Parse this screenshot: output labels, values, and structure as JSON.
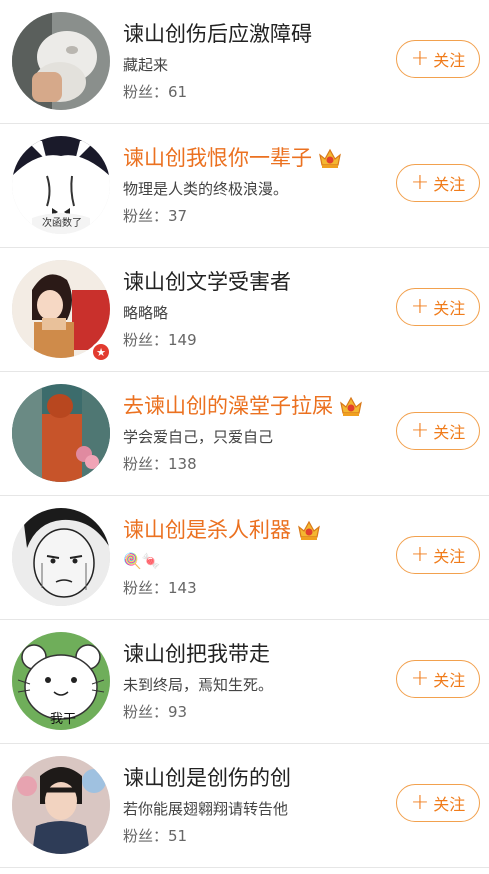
{
  "follow_label": "关注",
  "follow_plus": "+",
  "fans_prefix": "粉丝：",
  "colors": {
    "vip_name": "#eb7120",
    "normal_name": "#222222",
    "button_border": "#f2a14e"
  },
  "users": [
    {
      "name": "谏山创伤后应激障碍",
      "vip": false,
      "bio": "藏起来",
      "fans": "61",
      "avatar": "cat-photo"
    },
    {
      "name": "谏山创我恨你一辈子",
      "vip": true,
      "bio": "物理是人类的终极浪漫。",
      "fans": "37",
      "avatar": "cartoon-cat",
      "avatar_text": "次函数了"
    },
    {
      "name": "谏山创文学受害者",
      "vip": false,
      "bio": "略略略",
      "fans": "149",
      "avatar": "anime-girl",
      "badge": true
    },
    {
      "name": "去谏山创的澡堂子拉屎",
      "vip": true,
      "bio": "学会爱自己，只爱自己",
      "fans": "138",
      "avatar": "painting"
    },
    {
      "name": "谏山创是杀人利器",
      "vip": true,
      "bio": "🍭🍬",
      "fans": "143",
      "avatar": "manga-face"
    },
    {
      "name": "谏山创把我带走",
      "vip": false,
      "bio": "未到终局，焉知生死。",
      "fans": "93",
      "avatar": "white-bear",
      "avatar_text": "我干"
    },
    {
      "name": "谏山创是创伤的创",
      "vip": false,
      "bio": "若你能展翅翱翔请转告他",
      "fans": "51",
      "avatar": "girl-photo"
    }
  ]
}
